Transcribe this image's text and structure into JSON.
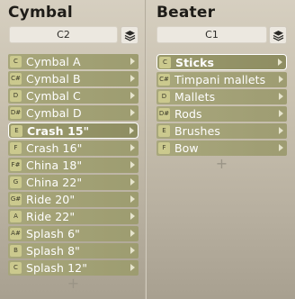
{
  "cymbal": {
    "title": "Cymbal",
    "selector_value": "C2",
    "items": [
      {
        "note": "C",
        "label": "Cymbal A",
        "selected": false
      },
      {
        "note": "C#",
        "label": "Cymbal B",
        "selected": false
      },
      {
        "note": "D",
        "label": "Cymbal C",
        "selected": false
      },
      {
        "note": "D#",
        "label": "Cymbal D",
        "selected": false
      },
      {
        "note": "E",
        "label": "Crash 15\"",
        "selected": true
      },
      {
        "note": "F",
        "label": "Crash 16\"",
        "selected": false
      },
      {
        "note": "F#",
        "label": "China 18\"",
        "selected": false
      },
      {
        "note": "G",
        "label": "China 22\"",
        "selected": false
      },
      {
        "note": "G#",
        "label": "Ride 20\"",
        "selected": false
      },
      {
        "note": "A",
        "label": "Ride 22\"",
        "selected": false
      },
      {
        "note": "A#",
        "label": "Splash 6\"",
        "selected": false
      },
      {
        "note": "B",
        "label": "Splash 8\"",
        "selected": false
      },
      {
        "note": "C",
        "label": "Splash 12\"",
        "selected": false
      }
    ],
    "add_label": "+"
  },
  "beater": {
    "title": "Beater",
    "selector_value": "C1",
    "items": [
      {
        "note": "C",
        "label": "Sticks",
        "selected": true
      },
      {
        "note": "C#",
        "label": "Timpani mallets",
        "selected": false
      },
      {
        "note": "D",
        "label": "Mallets",
        "selected": false
      },
      {
        "note": "D#",
        "label": "Rods",
        "selected": false
      },
      {
        "note": "E",
        "label": "Brushes",
        "selected": false
      },
      {
        "note": "F",
        "label": "Bow",
        "selected": false
      }
    ],
    "add_label": "+"
  },
  "colors": {
    "item_bg": "#a7a67a",
    "note_badge": "#cbc98e",
    "selected_border": "#ffffff"
  },
  "icons": {
    "layers": "layers-icon",
    "arrow": "chevron-right-icon"
  }
}
